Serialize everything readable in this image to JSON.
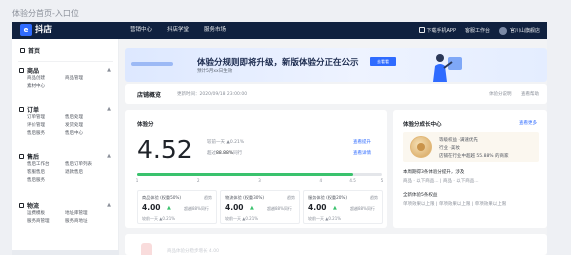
{
  "caption": "体验分首页-入口位",
  "topbar": {
    "logo_text": "抖店",
    "logo_mark": "e",
    "nav": [
      "营销中心",
      "抖店学堂",
      "服务市场"
    ],
    "download": "下载手机APP",
    "service": "客服工作台",
    "shop_name": "官川山旗舰店"
  },
  "sidebar": {
    "home": "首页",
    "sections": [
      {
        "title": "商品",
        "items": [
          "商品创建",
          "商品管理",
          "素材中心"
        ]
      },
      {
        "title": "订单",
        "items": [
          "订单管理",
          "售后处理",
          "评价管理",
          "发货处理",
          "售后服务",
          "售后中心"
        ]
      },
      {
        "title": "售后",
        "items": [
          "售后工作台",
          "售后订单列表",
          "客服售后",
          "退款售后",
          "售后服务"
        ]
      },
      {
        "title": "物流",
        "items": [
          "运费模板",
          "地址库管理",
          "服务商管理",
          "服务商地址"
        ]
      }
    ]
  },
  "banner": {
    "title": "体验分规则即将升级，新版体验分正在公示",
    "subtitle": "预计5月xx日生效",
    "button": "去看看"
  },
  "info_bar": {
    "title": "店铺概览",
    "update_time": "更新时间：2020/09/18 23:00:00",
    "links": [
      "体验分说明",
      "查看帮助"
    ]
  },
  "score_card": {
    "title": "体验分",
    "score": "4.52",
    "stat1": "较前一天 ▲0.21%",
    "stat2_prefix": "超过",
    "stat2_value": "88.88%",
    "stat2_suffix": "同行",
    "link_improve": "查看提升",
    "link_detail": "查看详情",
    "progress": 0.88,
    "ticks": [
      "1",
      "2",
      "3",
      "4",
      "4.5",
      "5"
    ],
    "subs": [
      {
        "label": "商品体验 (权重50%)",
        "trend": "趋势",
        "value": "4.00",
        "up": "▲",
        "pct": "超越88%同行",
        "foot": "较前一天 ▲0.21%"
      },
      {
        "label": "物流体验 (权重30%)",
        "trend": "趋势",
        "value": "4.00",
        "up": "▲",
        "pct": "超越88%同行",
        "foot": "较前一天 ▲0.21%"
      },
      {
        "label": "服务体验 (权重20%)",
        "trend": "趋势",
        "value": "4.00",
        "up": "▲",
        "pct": "超越88%同行",
        "foot": "较前一天 ▲0.21%"
      }
    ]
  },
  "side_card": {
    "title": "体验分成长中心",
    "link": "查看更多",
    "medal_lines": [
      "等级权益 ·满速优先",
      "行业 ·美妆",
      "店铺在行业中超越 55.88% 的商家"
    ],
    "row1": "本周期得3条体验分提升，涉及",
    "row2": "商品 · 以下商品... | 商品 · 以下商品...",
    "row3": "全新体验5条权益",
    "row4": "单项效果以上限 | 单项效果以上限 | 单项效果以上限"
  },
  "bottom_card": {
    "text": "商品体验分稳步增长 4.00"
  },
  "colors": {
    "topbar": "#10213f",
    "accent": "#2f6bff",
    "progress": "#3ac26d"
  }
}
